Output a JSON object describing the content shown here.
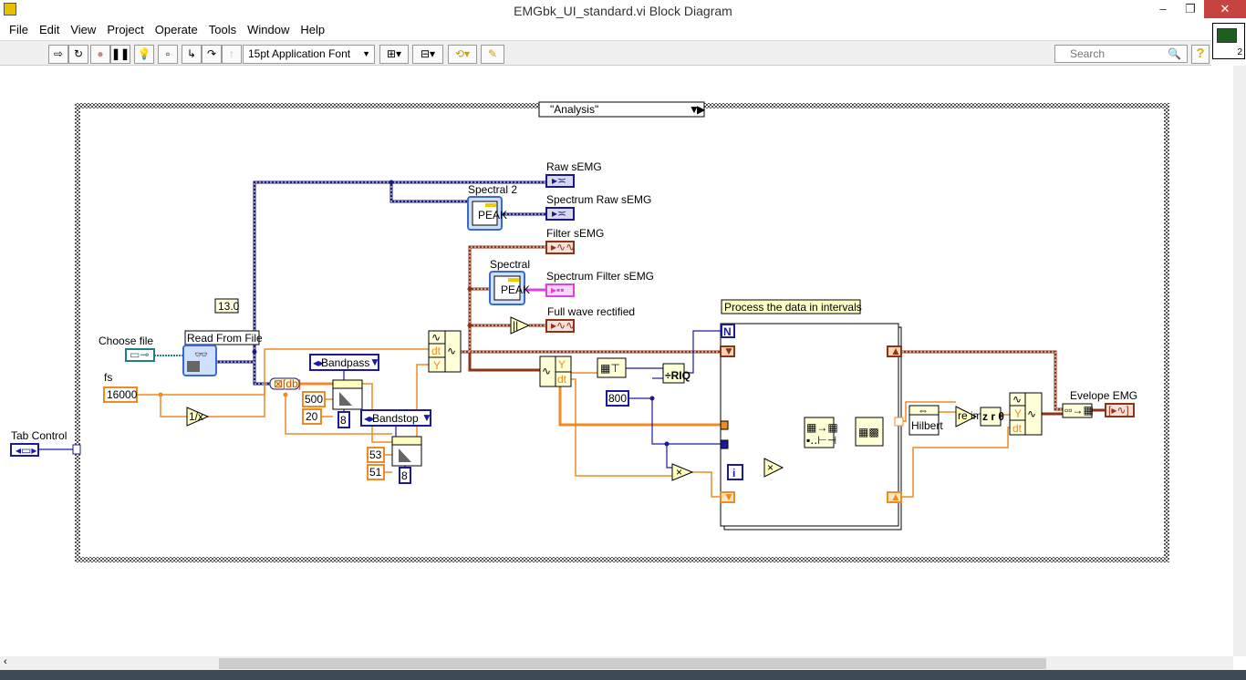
{
  "window": {
    "title": "EMGbk_UI_standard.vi Block Diagram",
    "minimize": "–",
    "restore": "❐",
    "close": "✕"
  },
  "menu": [
    "File",
    "Edit",
    "View",
    "Project",
    "Operate",
    "Tools",
    "Window",
    "Help"
  ],
  "toolbar": {
    "font": "15pt Application Font",
    "search_placeholder": "Search",
    "help": "?",
    "connector_number": "2"
  },
  "diagram": {
    "case_selector": "\"Analysis\"",
    "tab_control": "Tab Control",
    "version_constant": "13.0",
    "choose_file": "Choose file",
    "read_from_file": "Read From File",
    "fs_label": "fs",
    "fs_value": "16000",
    "bandpass": "Bandpass",
    "bandpass_high": "500",
    "bandpass_low": "20",
    "bandpass_order": "8",
    "bandstop": "Bandstop",
    "bandstop_high": "53",
    "bandstop_low": "51",
    "bandstop_order": "8",
    "raw_semg": "Raw sEMG",
    "spectral2": "Spectral 2",
    "spectrum_raw": "Spectrum Raw sEMG",
    "filter_semg": "Filter sEMG",
    "spectral": "Spectral",
    "spectrum_filter": "Spectrum Filter sEMG",
    "full_wave": "Full wave rectified",
    "comment": "Process the data in intervals",
    "interval_constant": "800",
    "loop_count": "N",
    "loop_index": "i",
    "hilbert": "Hilbert",
    "envelope": "Evelope EMG",
    "wf_y": "Y",
    "wf_dt": "dt"
  },
  "colors": {
    "orange": "#f08a24",
    "blue": "#1a1aa0",
    "dynamic": "#1a1a80",
    "waveform": "#8c3418",
    "pink": "#e040e0",
    "teal": "#208080"
  }
}
